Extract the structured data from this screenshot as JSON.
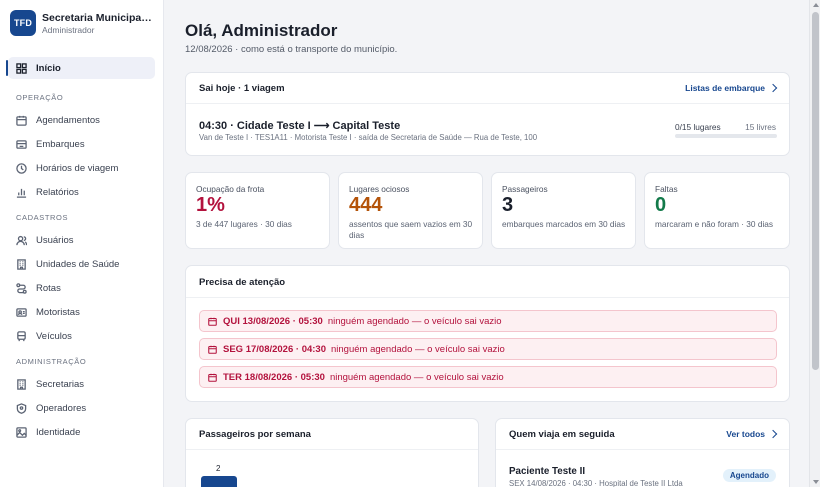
{
  "brand": {
    "logo": "TFD",
    "name": "Secretaria Municipal d...",
    "subtitle": "Administrador"
  },
  "nav": {
    "home": {
      "label": "Início",
      "icon": "grid-icon"
    },
    "operacao": {
      "title": "OPERAÇÃO",
      "items": [
        {
          "label": "Agendamentos",
          "icon": "calendar-icon"
        },
        {
          "label": "Embarques",
          "icon": "boarding-icon"
        },
        {
          "label": "Horários de viagem",
          "icon": "clock-icon"
        },
        {
          "label": "Relatórios",
          "icon": "bar-chart-icon"
        }
      ]
    },
    "cadastros": {
      "title": "CADASTROS",
      "items": [
        {
          "label": "Usuários",
          "icon": "users-icon"
        },
        {
          "label": "Unidades de Saúde",
          "icon": "building-icon"
        },
        {
          "label": "Rotas",
          "icon": "route-icon"
        },
        {
          "label": "Motoristas",
          "icon": "id-card-icon"
        },
        {
          "label": "Veículos",
          "icon": "bus-icon"
        }
      ]
    },
    "administracao": {
      "title": "ADMINISTRAÇÃO",
      "items": [
        {
          "label": "Secretarias",
          "icon": "building-icon"
        },
        {
          "label": "Operadores",
          "icon": "shield-icon"
        },
        {
          "label": "Identidade",
          "icon": "image-icon"
        }
      ]
    }
  },
  "header": {
    "greeting": "Olá, Administrador",
    "subtitle": "12/08/2026 · como está o transporte do município."
  },
  "today": {
    "title": "Sai hoje · 1 viagem",
    "link": "Listas de embarque",
    "trip_title": "04:30 · Cidade Teste I ⟶ Capital Teste",
    "trip_meta": "Van de Teste I · TES1A11 · Motorista Teste I · saída de Secretaria de Saúde — Rua de Teste, 100",
    "seats_used": "0/15 lugares",
    "seats_free": "15 livres",
    "occupancy_fraction": 0
  },
  "stats": [
    {
      "label": "Ocupação da frota",
      "value": "1%",
      "note": "3 de 447 lugares · 30 dias",
      "color": "#b3123d"
    },
    {
      "label": "Lugares ociosos",
      "value": "444",
      "note": "assentos que saem vazios em 30 dias",
      "color": "#b45309"
    },
    {
      "label": "Passageiros",
      "value": "3",
      "note": "embarques marcados em 30 dias",
      "color": "#1a1f2b"
    },
    {
      "label": "Faltas",
      "value": "0",
      "note": "marcaram e não foram · 30 dias",
      "color": "#137a4a"
    }
  ],
  "attention": {
    "title": "Precisa de atenção",
    "alerts": [
      {
        "date": "QUI 13/08/2026 · 05:30",
        "text": "ninguém agendado — o veículo sai vazio"
      },
      {
        "date": "SEG 17/08/2026 · 04:30",
        "text": "ninguém agendado — o veículo sai vazio"
      },
      {
        "date": "TER 18/08/2026 · 05:30",
        "text": "ninguém agendado — o veículo sai vazio"
      }
    ]
  },
  "weekly": {
    "title": "Passageiros por semana",
    "bar_value_label": "2"
  },
  "next": {
    "title": "Quem viaja em seguida",
    "link": "Ver todos",
    "name": "Paciente Teste II",
    "meta": "SEX 14/08/2026 · 04:30 · Hospital de Teste II Ltda",
    "badge": "Agendado"
  },
  "colors": {
    "accent": "#17478f",
    "danger": "#b3123d"
  }
}
